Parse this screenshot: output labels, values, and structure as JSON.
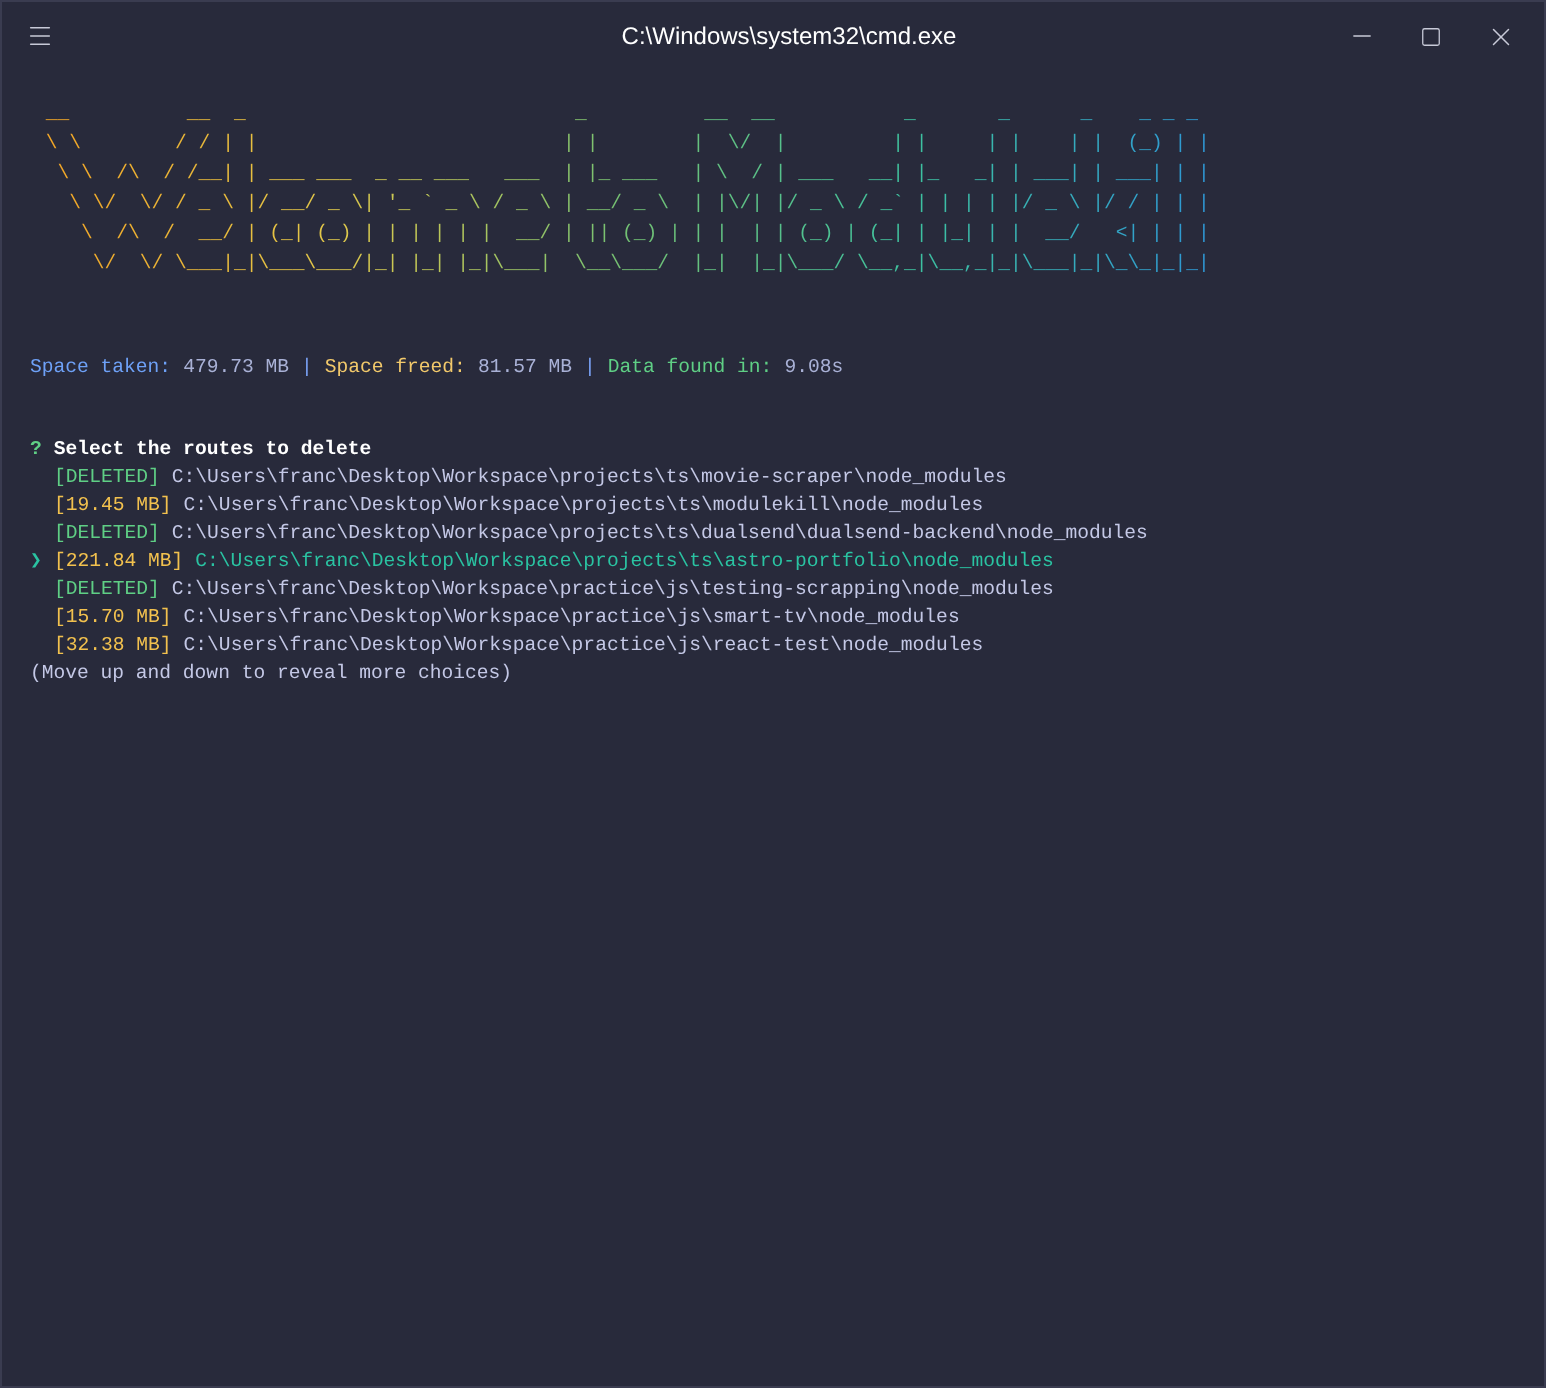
{
  "window": {
    "title": "C:\\Windows\\system32\\cmd.exe"
  },
  "banner": {
    "lines": [
      " __          __  _                            _          __  __           _       _      _    _ _ _",
      " \\ \\        / / | |                          | |        |  \\/  |         | |     | |    | |  (_) | |",
      "  \\ \\  /\\  / /__| | ___ ___  _ __ ___   ___  | |_ ___   | \\  / | ___   __| |_   _| | ___| | ___| | |",
      "   \\ \\/  \\/ / _ \\ |/ __/ _ \\| '_ ` _ \\ / _ \\ | __/ _ \\  | |\\/| |/ _ \\ / _` | | | | |/ _ \\ |/ / | | |",
      "    \\  /\\  /  __/ | (_| (_) | | | | | |  __/ | || (_) | | |  | | (_) | (_| | |_| | |  __/   <| | | |",
      "     \\/  \\/ \\___|_|\\___\\___/|_| |_| |_|\\___|  \\__\\___/  |_|  |_|\\___/ \\__,_|\\__,_|_|\\___|_|\\_\\_|_|_|"
    ]
  },
  "stats": [
    {
      "label": "Space taken:",
      "value": "479.73 MB",
      "color": "#6ea1f7",
      "separator": "|"
    },
    {
      "label": "Space freed:",
      "value": "81.57 MB",
      "color": "#f2c96b",
      "separator": "|"
    },
    {
      "label": "Data found in:",
      "value": "9.08s",
      "color": "#5fcf85"
    }
  ],
  "prompt": {
    "mark": "?",
    "title": "Select the routes to delete",
    "cursor": "❯"
  },
  "routes": [
    {
      "kind": "deleted",
      "tag": "[DELETED]",
      "path": "C:\\Users\\franc\\Desktop\\Workspace\\projects\\ts\\movie-scraper\\node_modules",
      "selected": false
    },
    {
      "kind": "size",
      "tag": "[19.45 MB]",
      "path": "C:\\Users\\franc\\Desktop\\Workspace\\projects\\ts\\modulekill\\node_modules",
      "selected": false
    },
    {
      "kind": "deleted",
      "tag": "[DELETED]",
      "path": "C:\\Users\\franc\\Desktop\\Workspace\\projects\\ts\\dualsend\\dualsend-backend\\node_modules",
      "selected": false
    },
    {
      "kind": "size",
      "tag": "[221.84 MB]",
      "path": "C:\\Users\\franc\\Desktop\\Workspace\\projects\\ts\\astro-portfolio\\node_modules",
      "selected": true
    },
    {
      "kind": "deleted",
      "tag": "[DELETED]",
      "path": "C:\\Users\\franc\\Desktop\\Workspace\\practice\\js\\testing-scrapping\\node_modules",
      "selected": false
    },
    {
      "kind": "size",
      "tag": "[15.70 MB]",
      "path": "C:\\Users\\franc\\Desktop\\Workspace\\practice\\js\\smart-tv\\node_modules",
      "selected": false
    },
    {
      "kind": "size",
      "tag": "[32.38 MB]",
      "path": "C:\\Users\\franc\\Desktop\\Workspace\\practice\\js\\react-test\\node_modules",
      "selected": false
    }
  ],
  "hint": "(Move up and down to reveal more choices)"
}
